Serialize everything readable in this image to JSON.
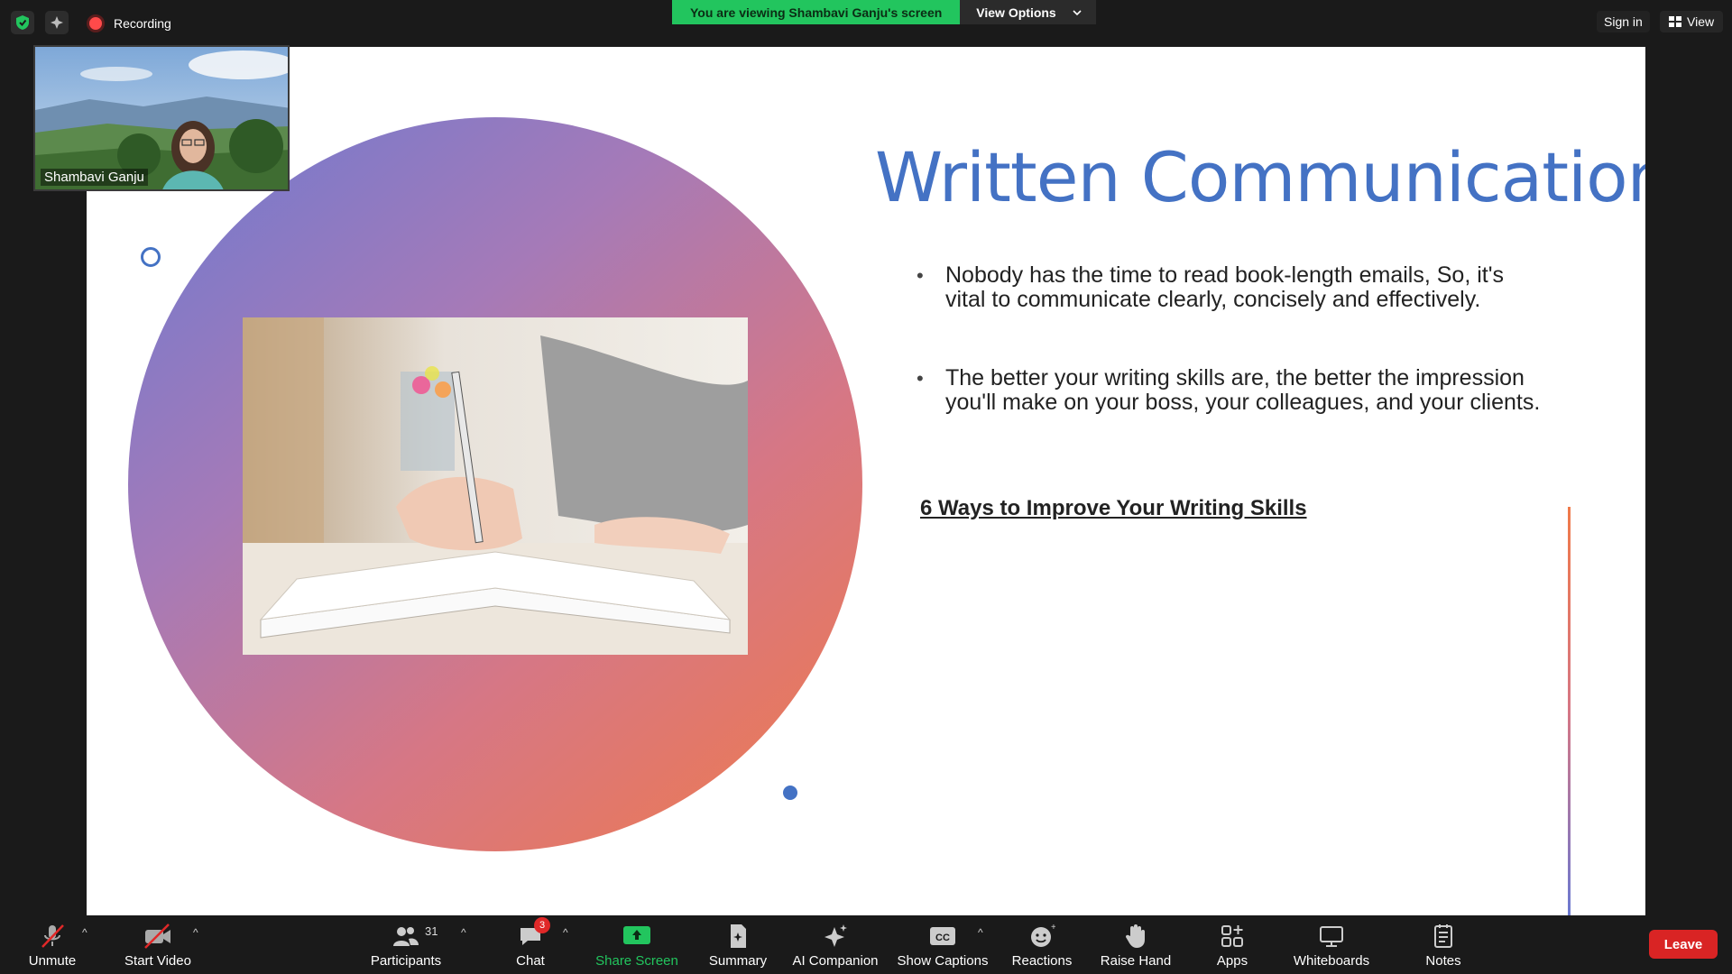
{
  "topbar": {
    "recording_label": "Recording",
    "viewing_text": "You are viewing Shambavi Ganju's screen",
    "view_options_label": "View Options",
    "sign_in_label": "Sign in",
    "view_label": "View"
  },
  "participant": {
    "name": "Shambavi Ganju"
  },
  "slide": {
    "title": "Written Communication",
    "bullets": [
      "Nobody has the time to read book-length emails, So, it's vital to communicate clearly, concisely and effectively.",
      "The better your writing skills are, the better the impression you'll make on your boss, your colleagues, and your clients."
    ],
    "subheading": "6 Ways to Improve Your Writing Skills"
  },
  "toolbar": {
    "unmute": "Unmute",
    "start_video": "Start Video",
    "participants": "Participants",
    "participants_count": "31",
    "chat": "Chat",
    "chat_badge": "3",
    "share_screen": "Share Screen",
    "summary": "Summary",
    "ai_companion": "AI Companion",
    "show_captions": "Show Captions",
    "reactions": "Reactions",
    "raise_hand": "Raise Hand",
    "apps": "Apps",
    "whiteboards": "Whiteboards",
    "notes": "Notes",
    "leave": "Leave"
  },
  "colors": {
    "slide_accent": "#4472c4",
    "share_green": "#22c55e",
    "leave_red": "#d92424"
  }
}
